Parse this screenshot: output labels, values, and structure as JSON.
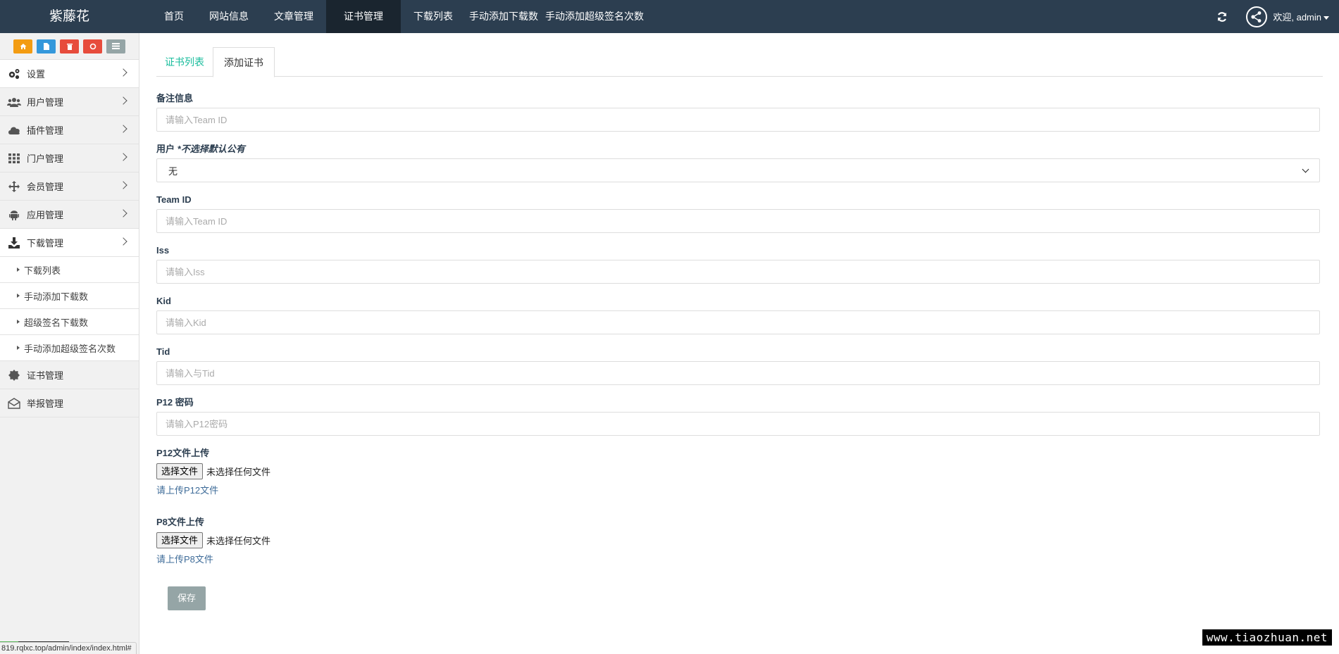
{
  "header": {
    "brand": "紫藤花",
    "nav": [
      {
        "label": "首页"
      },
      {
        "label": "网站信息"
      },
      {
        "label": "文章管理"
      },
      {
        "label": "证书管理",
        "active": true
      },
      {
        "label": "下载列表"
      },
      {
        "label": "手动添加下载数"
      },
      {
        "label": "手动添加超级签名次数"
      }
    ],
    "welcome": "欢迎, admin"
  },
  "sidebar": {
    "quick_buttons": [
      {
        "icon": "home-icon",
        "color": "#f39c12"
      },
      {
        "icon": "file-icon",
        "color": "#3498db"
      },
      {
        "icon": "trash-icon",
        "color": "#e74c3c"
      },
      {
        "icon": "recycle-icon",
        "color": "#e74c3c"
      },
      {
        "icon": "list-icon",
        "color": "#95a5a6"
      }
    ],
    "items": [
      {
        "label": "设置",
        "icon": "gears-icon"
      },
      {
        "label": "用户管理",
        "icon": "users-icon"
      },
      {
        "label": "插件管理",
        "icon": "cloud-icon"
      },
      {
        "label": "门户管理",
        "icon": "grid-icon"
      },
      {
        "label": "会员管理",
        "icon": "move-icon"
      },
      {
        "label": "应用管理",
        "icon": "android-icon"
      },
      {
        "label": "下载管理",
        "icon": "download-icon"
      },
      {
        "label": "证书管理",
        "icon": "certificate-icon"
      },
      {
        "label": "举报管理",
        "icon": "envelope-icon"
      }
    ],
    "sub_items": [
      {
        "label": "下载列表"
      },
      {
        "label": "手动添加下载数"
      },
      {
        "label": "超级签名下载数"
      },
      {
        "label": "手动添加超级签名次数"
      }
    ]
  },
  "tabs": [
    {
      "label": "证书列表"
    },
    {
      "label": "添加证书",
      "active": true
    }
  ],
  "form": {
    "remark": {
      "label": "备注信息",
      "placeholder": "请输入Team ID"
    },
    "user": {
      "label": "用户",
      "note": "*不选择默认公有",
      "value": "无"
    },
    "team_id": {
      "label": "Team ID",
      "placeholder": "请输入Team ID"
    },
    "iss": {
      "label": "Iss",
      "placeholder": "请输入Iss"
    },
    "kid": {
      "label": "Kid",
      "placeholder": "请输入Kid"
    },
    "tid": {
      "label": "Tid",
      "placeholder": "请输入与Tid"
    },
    "p12_password": {
      "label": "P12 密码",
      "placeholder": "请输入P12密码"
    },
    "p12_file": {
      "label": "P12文件上传",
      "button": "选择文件",
      "status": "未选择任何文件",
      "help": "请上传P12文件"
    },
    "p8_file": {
      "label": "P8文件上传",
      "button": "选择文件",
      "status": "未选择任何文件",
      "help": "请上传P8文件"
    },
    "save": "保存"
  },
  "statusbar": {
    "url": "819.rqlxc.top/admin/index/index.html#"
  },
  "watermark": "www.tiaozhuan.net"
}
